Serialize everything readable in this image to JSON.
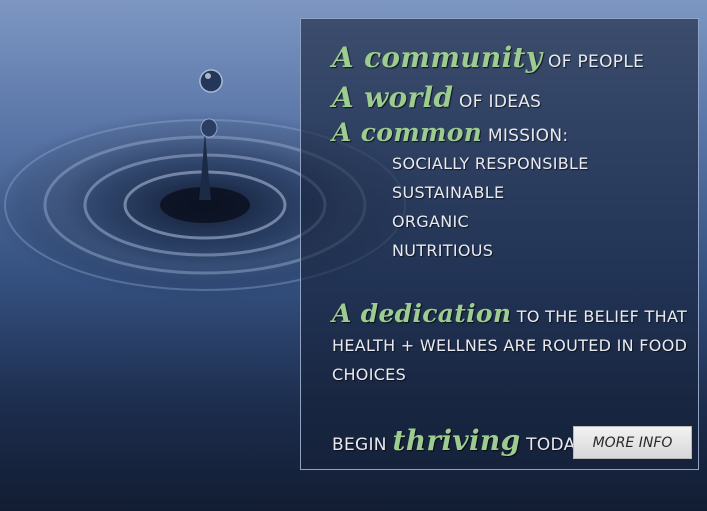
{
  "panel": {
    "line1": {
      "hl": "A community",
      "rest": "of people"
    },
    "line2": {
      "hl": "A world",
      "rest": "of ideas"
    },
    "line3": {
      "hl": "A common",
      "rest": "mission:"
    },
    "mission_items": [
      "socially responsible",
      "sustainable",
      "organic",
      "nutritious"
    ],
    "dedication": {
      "hl": "A dedication",
      "rest": "to the belief that health + wellnes are routed in food choices"
    },
    "cta": {
      "pre": "begin",
      "hl": "thriving",
      "post": "today!"
    },
    "more_button": "MORE INFO"
  },
  "colors": {
    "accent_green": "#9ccc8f",
    "panel_border": "#8fa3c2"
  }
}
